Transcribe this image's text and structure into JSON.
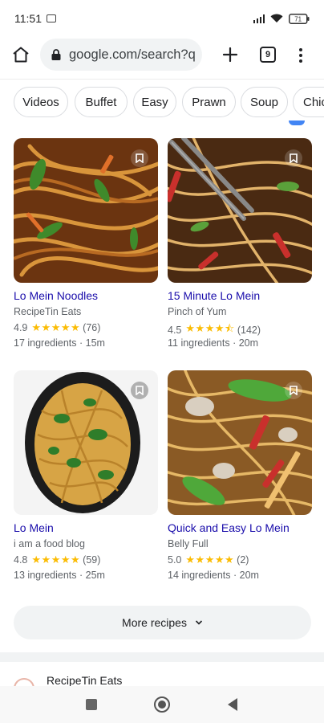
{
  "status_bar": {
    "time": "11:51",
    "battery": "71"
  },
  "browser": {
    "url": "google.com/search?q",
    "tab_count": "9",
    "icons": [
      "home-icon",
      "lock-icon",
      "plus-icon",
      "tabs-icon",
      "more-vert-icon"
    ]
  },
  "chips": [
    "Videos",
    "Buffet",
    "Easy",
    "Prawn",
    "Soup",
    "Chic"
  ],
  "recipes": [
    {
      "title": "Lo Mein Noodles",
      "source": "RecipeTin Eats",
      "rating": "4.9",
      "stars": "★★★★★",
      "reviews": "(76)",
      "meta": "17 ingredients · 15m"
    },
    {
      "title": "15 Minute Lo Mein",
      "source": "Pinch of Yum",
      "rating": "4.5",
      "stars": "★★★★⯪",
      "reviews": "(142)",
      "meta": "11 ingredients · 20m"
    },
    {
      "title": "Lo Mein",
      "source": "i am a food blog",
      "rating": "4.8",
      "stars": "★★★★★",
      "reviews": "(59)",
      "meta": "13 ingredients · 25m"
    },
    {
      "title": "Quick and Easy Lo Mein",
      "source": "Belly Full",
      "rating": "5.0",
      "stars": "★★★★★",
      "reviews": "(2)",
      "meta": "14 ingredients · 20m"
    }
  ],
  "more_button": {
    "label": "More recipes"
  },
  "next_result": {
    "source": "RecipeTin Eats"
  },
  "colors": {
    "link": "#1a0dab",
    "star": "#fbbc04",
    "chip_border": "#dadce0",
    "omnibox": "#f1f3f4"
  }
}
